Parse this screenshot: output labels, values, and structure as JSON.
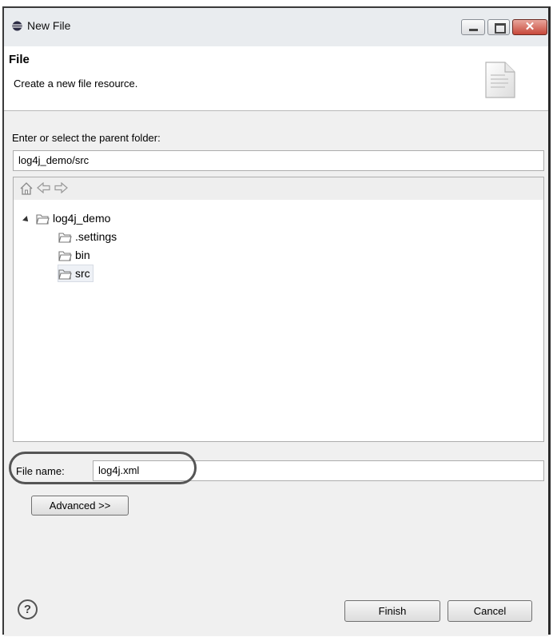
{
  "window": {
    "title": "New File"
  },
  "banner": {
    "title": "File",
    "description": "Create a new file resource."
  },
  "parent": {
    "label": "Enter or select the parent folder:",
    "value": "log4j_demo/src"
  },
  "tree": {
    "root": "log4j_demo",
    "children": [
      ".settings",
      "bin",
      "src"
    ],
    "selected": "src"
  },
  "filename": {
    "label": "File name:",
    "value": "log4j.xml"
  },
  "buttons": {
    "advanced": "Advanced >>",
    "finish": "Finish",
    "cancel": "Cancel",
    "help": "?"
  },
  "icons": {
    "title": "eclipse-icon",
    "banner": "new-file-icon",
    "home": "home-icon",
    "back": "back-arrow-icon",
    "forward": "forward-arrow-icon",
    "folder": "folder-icon"
  }
}
